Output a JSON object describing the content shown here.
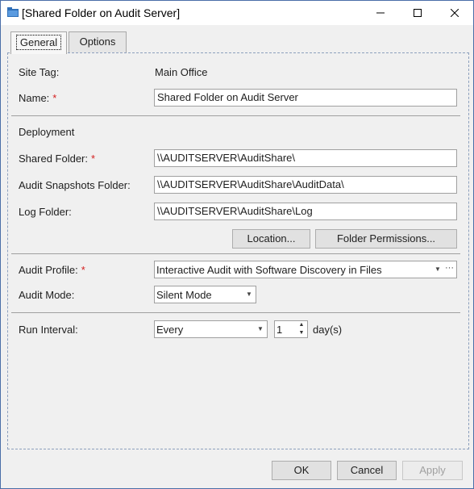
{
  "window": {
    "title": "[Shared Folder on Audit Server]"
  },
  "tabs": [
    {
      "label": "General"
    },
    {
      "label": "Options"
    }
  ],
  "general": {
    "site_tag_label": "Site Tag:",
    "site_tag_value": "Main Office",
    "name_label": "Name:",
    "name_value": "Shared Folder on Audit Server",
    "deployment_heading": "Deployment",
    "shared_folder_label": "Shared Folder:",
    "shared_folder_value": "\\\\AUDITSERVER\\AuditShare\\",
    "snapshots_label": "Audit Snapshots Folder:",
    "snapshots_value": "\\\\AUDITSERVER\\AuditShare\\AuditData\\",
    "log_label": "Log Folder:",
    "log_value": "\\\\AUDITSERVER\\AuditShare\\Log",
    "location_button": "Location...",
    "permissions_button": "Folder Permissions...",
    "profile_label": "Audit Profile:",
    "profile_value": "Interactive Audit with Software Discovery in Files",
    "profile_more": "···",
    "mode_label": "Audit Mode:",
    "mode_value": "Silent Mode",
    "interval_label": "Run Interval:",
    "interval_value": "Every",
    "interval_count": "1",
    "interval_unit": "day(s)",
    "required_marker": "*"
  },
  "footer": {
    "ok": "OK",
    "cancel": "Cancel",
    "apply": "Apply"
  }
}
